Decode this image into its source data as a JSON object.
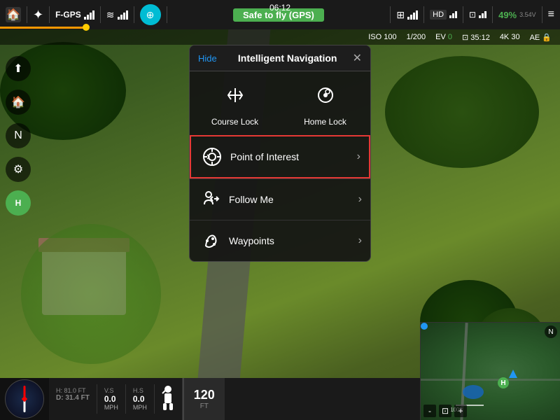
{
  "topBar": {
    "homeLabel": "🏠",
    "droneLabel": "✦",
    "gpsLabel": "F-GPS",
    "signalIcon": "📶",
    "wifiIcon": "≋",
    "safeToFly": "Safe to fly (GPS)",
    "rcIcon": "⊞",
    "hdLabel": "HD",
    "recordIcon": "🔲",
    "batteryPct": "49%",
    "batteryVolts": "3.54V",
    "menuIcon": "≡",
    "timer": "06:12"
  },
  "secondBar": {
    "iso": "ISO 100",
    "shutter": "1/200",
    "evLabel": "EV",
    "evValue": "0",
    "recordTime": "35:12",
    "resolution": "4K 30",
    "aeLabel": "AE",
    "lockIcon": "🔒"
  },
  "modal": {
    "hideLabel": "Hide",
    "title": "Intelligent Navigation",
    "closeIcon": "✕",
    "topItems": [
      {
        "id": "course-lock",
        "icon": "⊕",
        "label": "Course Lock"
      },
      {
        "id": "home-lock",
        "icon": "⌖",
        "label": "Home Lock"
      }
    ],
    "listItems": [
      {
        "id": "point-of-interest",
        "icon": "◎",
        "label": "Point of Interest",
        "highlighted": true,
        "arrow": "›"
      },
      {
        "id": "follow-me",
        "icon": "👤",
        "label": "Follow Me",
        "highlighted": false,
        "arrow": "›"
      },
      {
        "id": "waypoints",
        "icon": "⟳",
        "label": "Waypoints",
        "highlighted": false,
        "arrow": "›"
      }
    ]
  },
  "telemetry": {
    "hLabel": "H",
    "hValue": "81.0",
    "hUnit": "FT",
    "dLabel": "D",
    "dValue": "31.4",
    "dUnit": "FT",
    "vsLabel": "V.S",
    "vsValue": "0.0",
    "vsUnit": "MPH",
    "hsLabel": "H.S",
    "hsValue": "0.0",
    "hsUnit": "MPH",
    "altitude": "120",
    "altUnit": "FT"
  },
  "colors": {
    "accent": "#2196F3",
    "safe": "#4caf50",
    "warning": "#ff9800",
    "danger": "#e53935",
    "cyan": "#00bcd4"
  }
}
